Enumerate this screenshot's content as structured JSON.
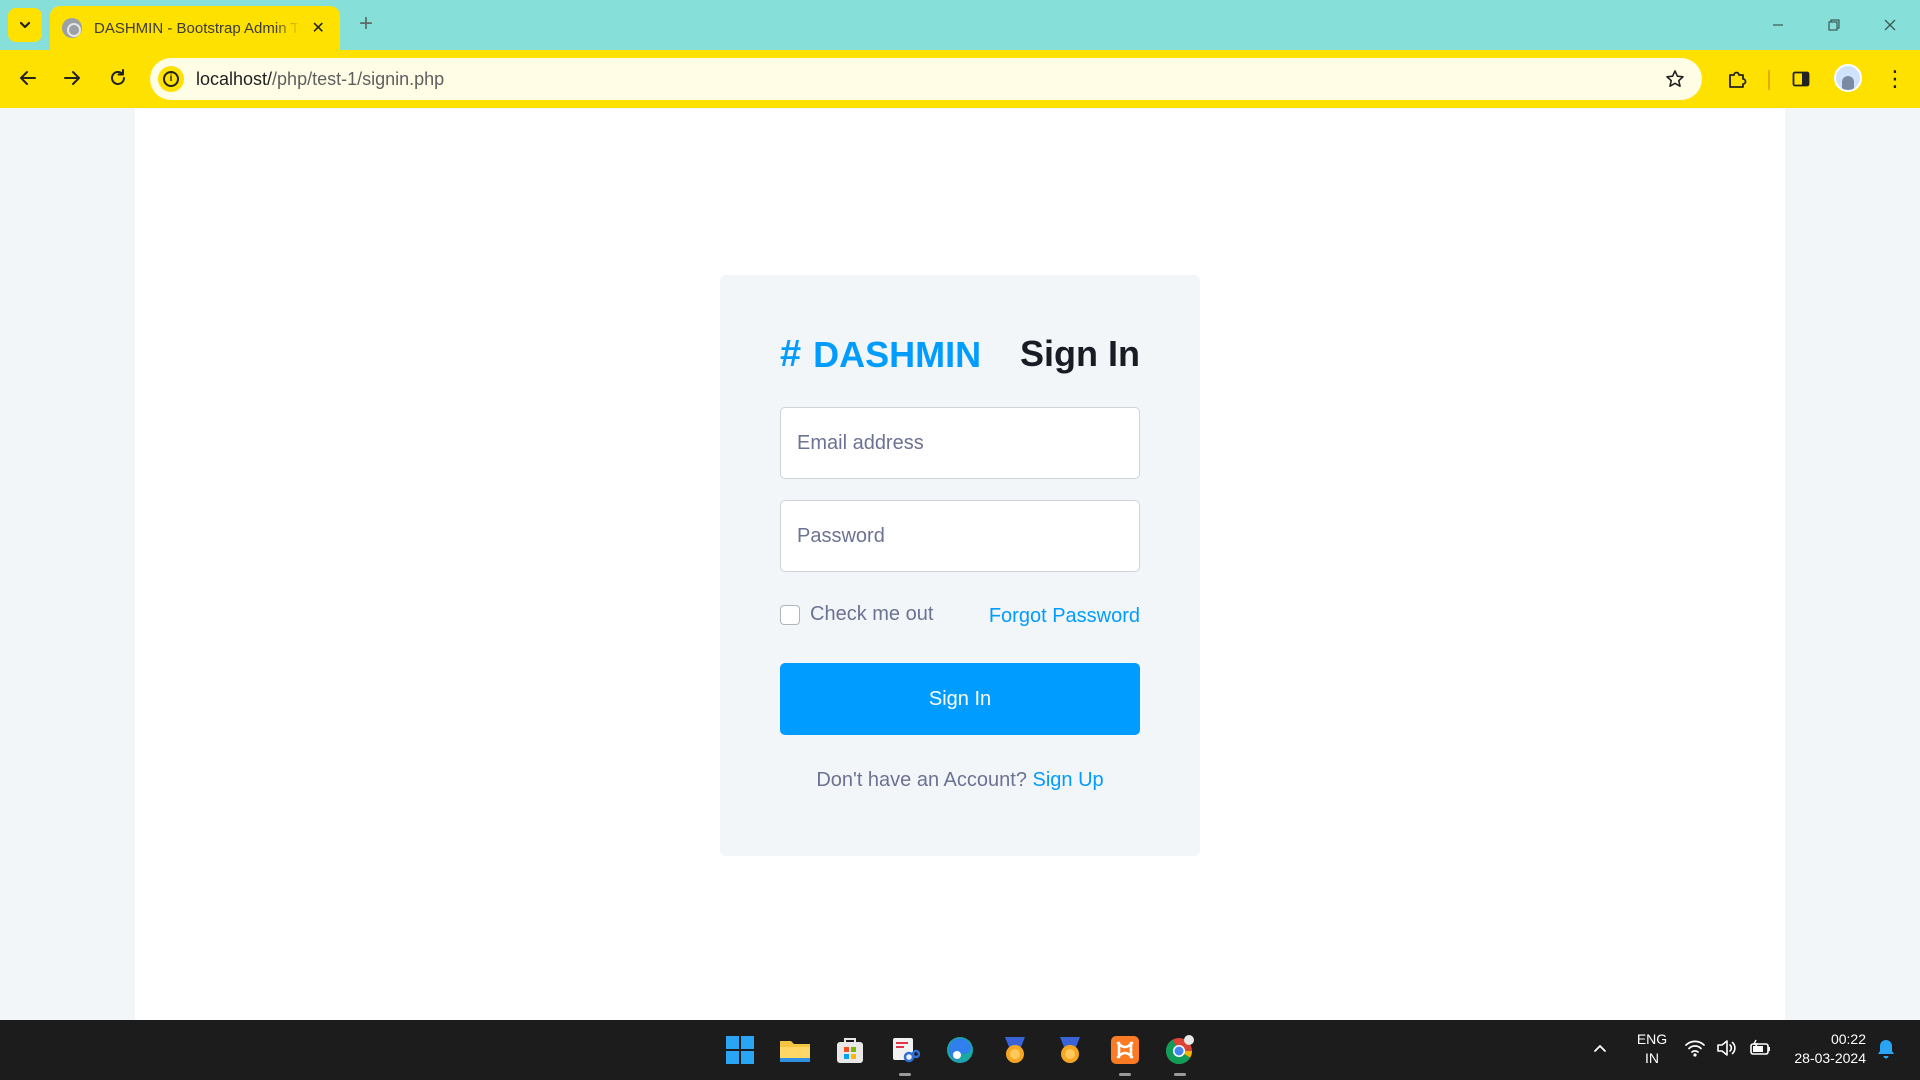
{
  "browser": {
    "tab_title": "DASHMIN - Bootstrap Admin Template",
    "tab_close": "✕",
    "new_tab": "+",
    "url_host": "localhost/",
    "url_path": "/php/test-1/signin.php",
    "site_info_glyph": "i",
    "menu_glyph": "⋮"
  },
  "signin": {
    "brand_hash": "#",
    "brand_name": "DASHMIN",
    "title": "Sign In",
    "email_placeholder": "Email address",
    "password_placeholder": "Password",
    "remember_label": "Check me out",
    "forgot_label": "Forgot Password",
    "submit_label": "Sign In",
    "no_account_text": "Don't have an Account?",
    "signup_label": "Sign Up"
  },
  "taskbar": {
    "apps": [
      "start-icon",
      "file-explorer-icon",
      "microsoft-store-icon",
      "snipping-tool-icon",
      "edge-icon",
      "badge-app-icon",
      "badge-app-2-icon",
      "xampp-icon",
      "chrome-icon"
    ],
    "chevron": "^",
    "lang_line1": "ENG",
    "lang_line2": "IN",
    "time": "00:22",
    "date": "28-03-2024"
  },
  "colors": {
    "accent": "#009cff",
    "chrome_yellow": "#ffe100",
    "tabstrip": "#86e0d9",
    "taskbar": "#1c1c1c"
  }
}
